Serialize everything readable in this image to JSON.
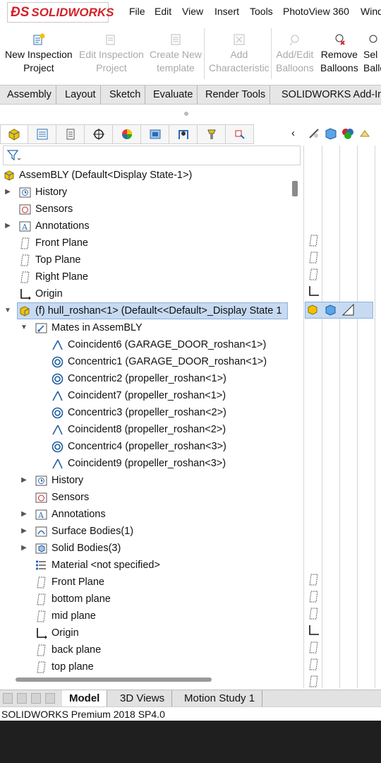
{
  "app": {
    "brand": "SOLIDWORKS",
    "brand_color": "#d2232a"
  },
  "menu": [
    "File",
    "Edit",
    "View",
    "Insert",
    "Tools",
    "PhotoView 360",
    "Wind"
  ],
  "commands": [
    {
      "line1": "New Inspection",
      "line2": "Project",
      "icon": "new-inspection-icon"
    },
    {
      "line1": "Edit Inspection",
      "line2": "Project",
      "icon": "edit-inspection-icon"
    },
    {
      "line1": "Create New",
      "line2": "template",
      "icon": "create-template-icon"
    },
    {
      "line1": "Add",
      "line2": "Characteristic",
      "icon": "add-characteristic-icon"
    },
    {
      "line1": "Add/Edit",
      "line2": "Balloons",
      "icon": "balloon-icon"
    },
    {
      "line1": "Remove",
      "line2": "Balloons",
      "icon": "remove-balloon-icon"
    },
    {
      "line1": "Sel",
      "line2": "Ballo",
      "icon": "select-balloon-icon"
    }
  ],
  "tabs": [
    "Assembly",
    "Layout",
    "Sketch",
    "Evaluate",
    "Render Tools",
    "SOLIDWORKS Add-In"
  ],
  "tree": {
    "root": "AssemBLY  (Default<Display State-1>)",
    "items": [
      {
        "label": "History",
        "icon": "history-icon"
      },
      {
        "label": "Sensors",
        "icon": "sensor-icon"
      },
      {
        "label": "Annotations",
        "icon": "annotation-icon"
      },
      {
        "label": "Front Plane",
        "icon": "plane-icon"
      },
      {
        "label": "Top Plane",
        "icon": "plane-icon"
      },
      {
        "label": "Right Plane",
        "icon": "plane-icon"
      },
      {
        "label": "Origin",
        "icon": "origin-icon"
      },
      {
        "label": "(f) hull_roshan<1> (Default<<Default>_Display State 1",
        "icon": "part-icon"
      },
      {
        "label": "Mates in AssemBLY",
        "icon": "mates-icon"
      },
      {
        "label": "Coincident6 (GARAGE_DOOR_roshan<1>)",
        "icon": "coincident-icon"
      },
      {
        "label": "Concentric1 (GARAGE_DOOR_roshan<1>)",
        "icon": "concentric-icon"
      },
      {
        "label": "Concentric2 (propeller_roshan<1>)",
        "icon": "concentric-icon"
      },
      {
        "label": "Coincident7 (propeller_roshan<1>)",
        "icon": "coincident-icon"
      },
      {
        "label": "Concentric3 (propeller_roshan<2>)",
        "icon": "concentric-icon"
      },
      {
        "label": "Coincident8 (propeller_roshan<2>)",
        "icon": "coincident-icon"
      },
      {
        "label": "Concentric4 (propeller_roshan<3>)",
        "icon": "concentric-icon"
      },
      {
        "label": "Coincident9 (propeller_roshan<3>)",
        "icon": "coincident-icon"
      },
      {
        "label": "History",
        "icon": "history-icon"
      },
      {
        "label": "Sensors",
        "icon": "sensor-icon"
      },
      {
        "label": "Annotations",
        "icon": "annotation-icon"
      },
      {
        "label": "Surface Bodies(1)",
        "icon": "surface-bodies-icon"
      },
      {
        "label": "Solid Bodies(3)",
        "icon": "solid-bodies-icon"
      },
      {
        "label": "Material <not specified>",
        "icon": "material-icon"
      },
      {
        "label": "Front Plane",
        "icon": "plane-icon"
      },
      {
        "label": "bottom plane",
        "icon": "plane-icon"
      },
      {
        "label": "mid plane",
        "icon": "plane-icon"
      },
      {
        "label": "Origin",
        "icon": "origin-icon"
      },
      {
        "label": "back plane",
        "icon": "plane-icon"
      },
      {
        "label": "top plane",
        "icon": "plane-icon"
      }
    ]
  },
  "bottom_tabs": [
    "Model",
    "3D Views",
    "Motion Study 1"
  ],
  "status": "SOLIDWORKS Premium 2018 SP4.0"
}
